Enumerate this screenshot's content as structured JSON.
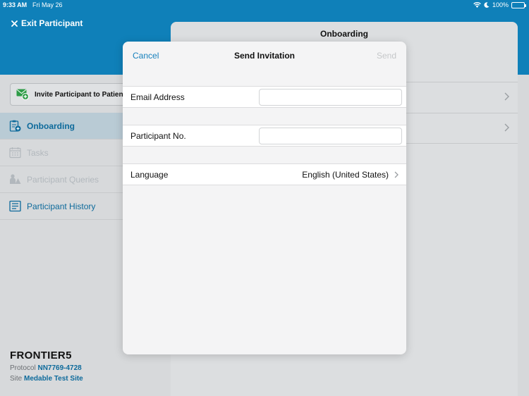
{
  "status_bar": {
    "time": "9:33 AM",
    "date": "Fri May 26",
    "battery": "100%",
    "battery_level": 1.0
  },
  "header": {
    "exit_label": "Exit Participant"
  },
  "sidebar": {
    "invite_label": "Invite Participant to Patien",
    "items": [
      {
        "label": "Onboarding",
        "icon": "clipboard-plus-icon",
        "state": "active"
      },
      {
        "label": "Tasks",
        "icon": "calendar-icon",
        "state": "disabled"
      },
      {
        "label": "Participant Queries",
        "icon": "people-queries-icon",
        "state": "disabled"
      },
      {
        "label": "Participant History",
        "icon": "history-list-icon",
        "state": "normal"
      }
    ]
  },
  "study": {
    "name": "FRONTIER5",
    "protocol_label": "Protocol",
    "protocol_value": "NN7769-4728",
    "site_label": "Site",
    "site_value": "Medable Test Site"
  },
  "panel": {
    "title": "Onboarding"
  },
  "modal": {
    "cancel_label": "Cancel",
    "title": "Send Invitation",
    "send_label": "Send",
    "email_label": "Email Address",
    "email_value": "",
    "participant_label": "Participant No.",
    "participant_value": "",
    "language_label": "Language",
    "language_value": "English (United States)"
  },
  "colors": {
    "accent": "#1781bd",
    "header": "#0f80b9",
    "disabled": "#c5c7c9"
  }
}
